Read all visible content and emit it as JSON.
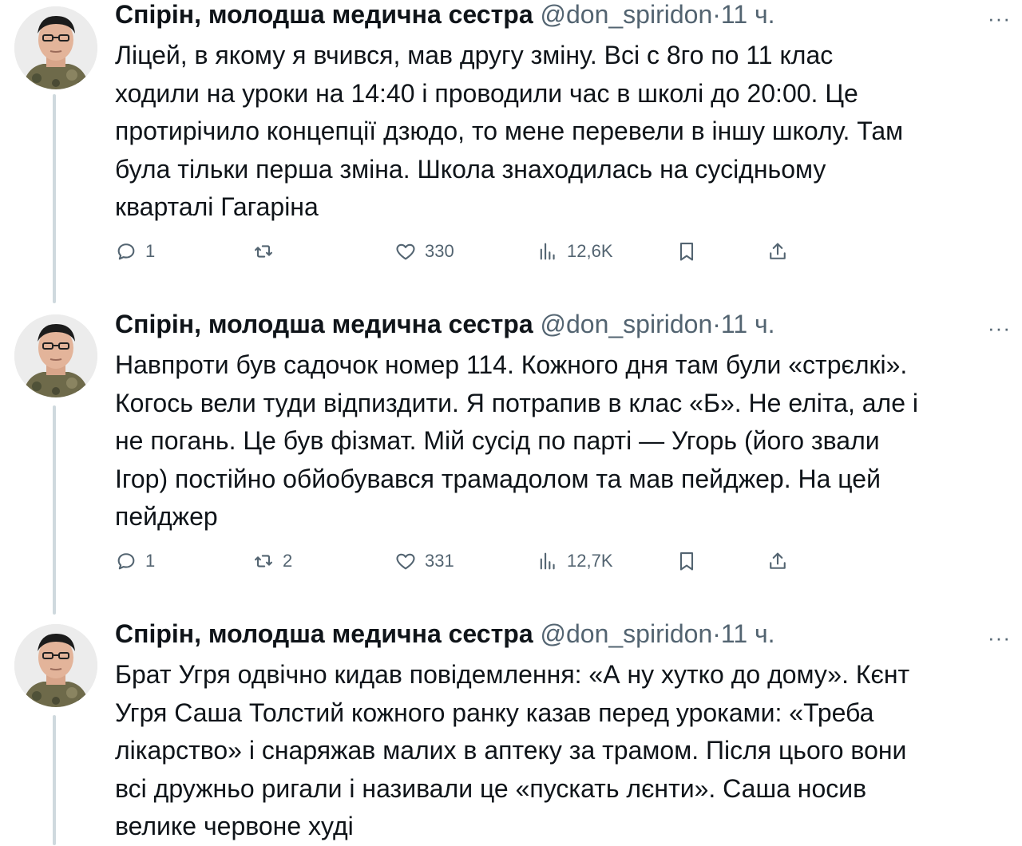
{
  "thread": [
    {
      "author_name": "Спірін, молодша медична сестра",
      "handle": "@don_spiridon",
      "separator": "·",
      "time": "11 ч.",
      "more": "···",
      "lines": [
        "Ліцей, в якому я вчився, мав другу зміну. Всі с 8го по 11 клас",
        "ходили на уроки на 14:40 і проводили час в школі до 20:00.  Це",
        "протирічило концепції дзюдо, то мене перевели в іншу школу. Там",
        "була тільки перша зміна. Школа знаходилась на сусідньому",
        "кварталі Гагаріна"
      ],
      "replies": "1",
      "retweets": "",
      "likes": "330",
      "views": "12,6K"
    },
    {
      "author_name": "Спірін, молодша медична сестра",
      "handle": "@don_spiridon",
      "separator": "·",
      "time": "11 ч.",
      "more": "···",
      "lines": [
        "Навпроти був садочок номер 114. Кожного дня там були «стрєлкі».",
        "Когось вели туди відпиздити. Я потрапив в клас «Б». Не еліта, але і",
        "не погань. Це був фізмат. Мій сусід по парті — Угорь (його звали",
        "Ігор) постійно обйобувався трамадолом та мав пейджер. На цей",
        "пейджер"
      ],
      "replies": "1",
      "retweets": "2",
      "likes": "331",
      "views": "12,7K"
    },
    {
      "author_name": "Спірін, молодша медична сестра",
      "handle": "@don_spiridon",
      "separator": "·",
      "time": "11 ч.",
      "more": "···",
      "lines": [
        "Брат Угря одвічно кидав повідемлення: «А ну хутко до дому». Кєнт",
        "Угря Саша Толстий кожного ранку казав перед уроками: «Треба",
        "лікарство» і снаряжав малих в аптеку за трамом. Після цього вони",
        "всі дружньо ригали і називали це «пускать лєнти». Саша носив",
        "велике червоне худі"
      ]
    }
  ],
  "colors": {
    "text": "#0f1419",
    "secondary": "#536471",
    "thread_line": "#cfd9de"
  }
}
